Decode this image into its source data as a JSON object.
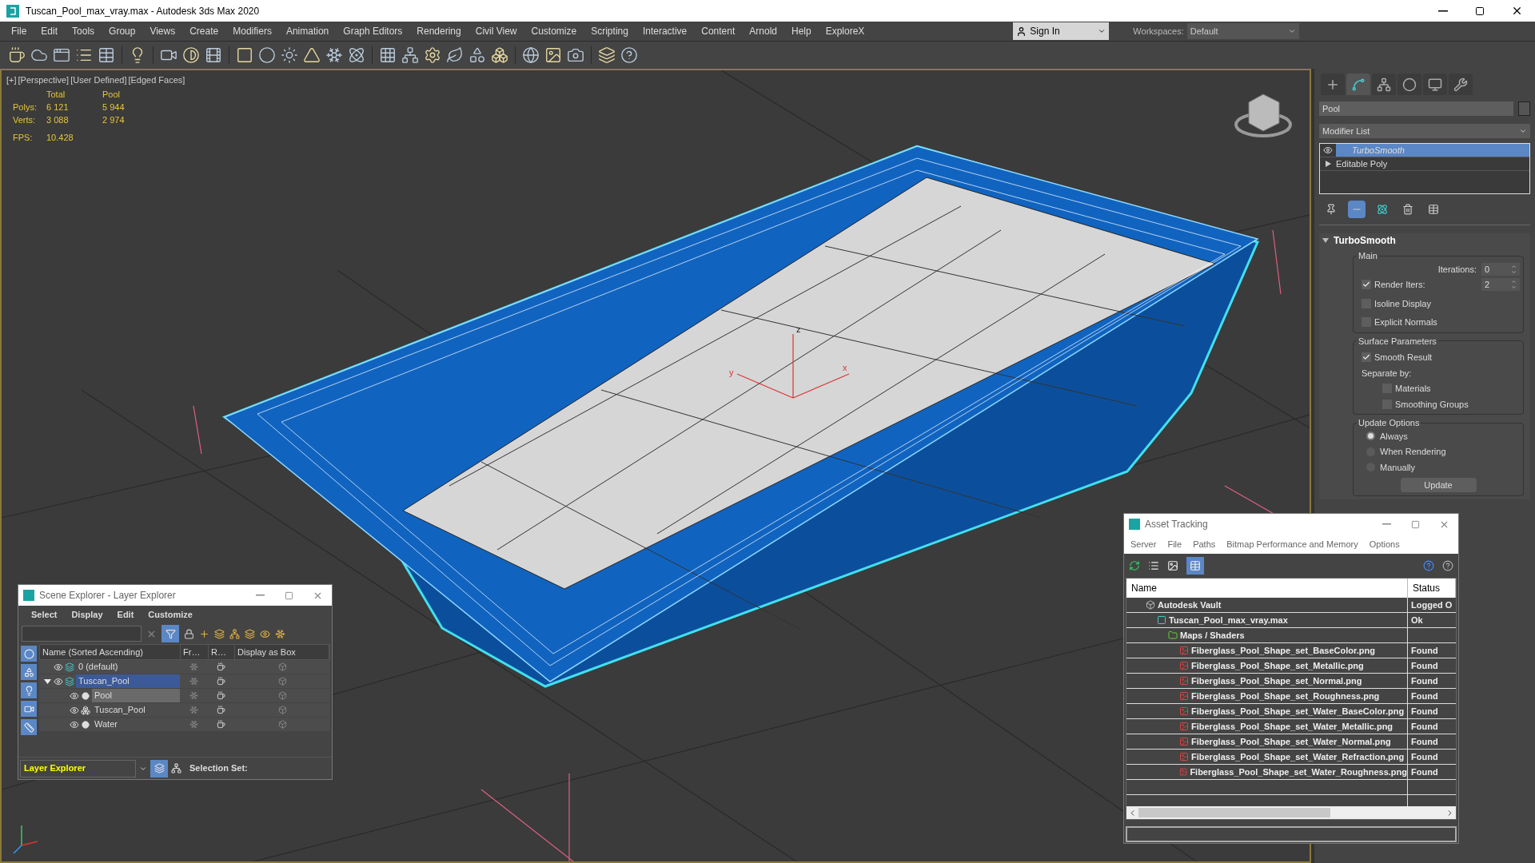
{
  "window": {
    "title": "Tuscan_Pool_max_vray.max - Autodesk 3ds Max 2020"
  },
  "menu": [
    "File",
    "Edit",
    "Tools",
    "Group",
    "Views",
    "Create",
    "Modifiers",
    "Animation",
    "Graph Editors",
    "Rendering",
    "Civil View",
    "Customize",
    "Scripting",
    "Interactive",
    "Content",
    "Arnold",
    "Help",
    "ExploreX"
  ],
  "account": {
    "label": "Sign In"
  },
  "workspaces": {
    "label": "Workspaces:",
    "value": "Default"
  },
  "viewport": {
    "labels": [
      "[+]",
      "[Perspective]",
      "[User Defined]",
      "[Edged Faces]"
    ],
    "stats": {
      "headers": [
        "Total",
        "Pool"
      ],
      "rows": [
        {
          "label": "Polys:",
          "values": [
            "6 121",
            "5 944"
          ]
        },
        {
          "label": "Verts:",
          "values": [
            "3 088",
            "2 974"
          ]
        }
      ]
    },
    "fps": {
      "label": "FPS:",
      "value": "10.428"
    },
    "gizmo_labels": [
      "z",
      "y",
      "x"
    ]
  },
  "command_panel": {
    "tabs": [
      {
        "selected": false
      },
      {
        "selected": true
      },
      {
        "selected": false
      },
      {
        "selected": false
      },
      {
        "selected": false
      },
      {
        "selected": false
      }
    ],
    "object_name": "Pool",
    "modifier_list": "Modifier List",
    "stack": [
      {
        "label": "TurboSmooth",
        "kind": "eye",
        "selected": true
      },
      {
        "label": "Editable Poly",
        "kind": "expand",
        "selected": false
      }
    ],
    "stack_tools": [
      {
        "on": false
      },
      {
        "on": true
      },
      {
        "on": false
      },
      {
        "on": false
      },
      {
        "on": false
      }
    ],
    "rollout": {
      "title": "TurboSmooth",
      "groups": [
        {
          "title": "Main",
          "items": [
            {
              "kind": "spinner",
              "label": "Iterations:",
              "value": "0"
            },
            {
              "kind": "checkspinner",
              "label": "Render Iters:",
              "value": "2",
              "checked": true
            },
            {
              "kind": "checkbox",
              "label": "Isoline Display",
              "checked": false
            },
            {
              "kind": "checkbox",
              "label": "Explicit Normals",
              "checked": false
            }
          ]
        },
        {
          "title": "Surface Parameters",
          "items": [
            {
              "kind": "checkbox",
              "label": "Smooth Result",
              "checked": true
            },
            {
              "kind": "text",
              "label": "Separate by:"
            },
            {
              "kind": "subcheckbox",
              "label": "Materials",
              "checked": false
            },
            {
              "kind": "subcheckbox",
              "label": "Smoothing Groups",
              "checked": false
            }
          ]
        },
        {
          "title": "Update Options",
          "items": [
            {
              "kind": "radio",
              "label": "Always",
              "selected": true
            },
            {
              "kind": "radio",
              "label": "When Rendering",
              "selected": false
            },
            {
              "kind": "radio",
              "label": "Manually",
              "selected": false
            },
            {
              "kind": "button",
              "label": "Update"
            }
          ]
        }
      ]
    }
  },
  "scene_explorer": {
    "title": "Scene Explorer - Layer Explorer",
    "menu": [
      "Select",
      "Display",
      "Edit",
      "Customize"
    ],
    "columns": [
      "Name (Sorted Ascending)",
      "Fr…",
      "R…",
      "Display as Box"
    ],
    "rows": [
      {
        "name": "0 (default)",
        "kind": "layer",
        "selected": false
      },
      {
        "name": "Tuscan_Pool",
        "kind": "layer",
        "selected": true,
        "expanded": true,
        "children": [
          {
            "name": "Pool",
            "kind": "object",
            "selected": true
          },
          {
            "name": "Tuscan_Pool",
            "kind": "group",
            "selected": false
          },
          {
            "name": "Water",
            "kind": "object",
            "selected": false
          }
        ]
      }
    ],
    "explorer_type": "Layer Explorer",
    "selection_set": "Selection Set:"
  },
  "asset_tracking": {
    "title": "Asset Tracking",
    "menu": [
      "Server",
      "File",
      "Paths",
      "Bitmap Performance and Memory",
      "Options"
    ],
    "columns": [
      "Name",
      "Status"
    ],
    "rows": [
      {
        "name": "Autodesk Vault",
        "kind": "vault",
        "status": "Logged O",
        "children": [
          {
            "name": "Tuscan_Pool_max_vray.max",
            "kind": "max",
            "status": "Ok",
            "children": [
              {
                "name": "Maps / Shaders",
                "kind": "folder",
                "children": [
                  {
                    "name": "Fiberglass_Pool_Shape_set_BaseColor.png",
                    "kind": "png",
                    "status": "Found"
                  },
                  {
                    "name": "Fiberglass_Pool_Shape_set_Metallic.png",
                    "kind": "png",
                    "status": "Found"
                  },
                  {
                    "name": "Fiberglass_Pool_Shape_set_Normal.png",
                    "kind": "png",
                    "status": "Found"
                  },
                  {
                    "name": "Fiberglass_Pool_Shape_set_Roughness.png",
                    "kind": "png",
                    "status": "Found"
                  },
                  {
                    "name": "Fiberglass_Pool_Shape_set_Water_BaseColor.png",
                    "kind": "png",
                    "status": "Found"
                  },
                  {
                    "name": "Fiberglass_Pool_Shape_set_Water_Metallic.png",
                    "kind": "png",
                    "status": "Found"
                  },
                  {
                    "name": "Fiberglass_Pool_Shape_set_Water_Normal.png",
                    "kind": "png",
                    "status": "Found"
                  },
                  {
                    "name": "Fiberglass_Pool_Shape_set_Water_Refraction.png",
                    "kind": "png",
                    "status": "Found"
                  },
                  {
                    "name": "Fiberglass_Pool_Shape_set_Water_Roughness.png",
                    "kind": "png",
                    "status": "Found"
                  }
                ]
              }
            ]
          }
        ]
      }
    ]
  }
}
